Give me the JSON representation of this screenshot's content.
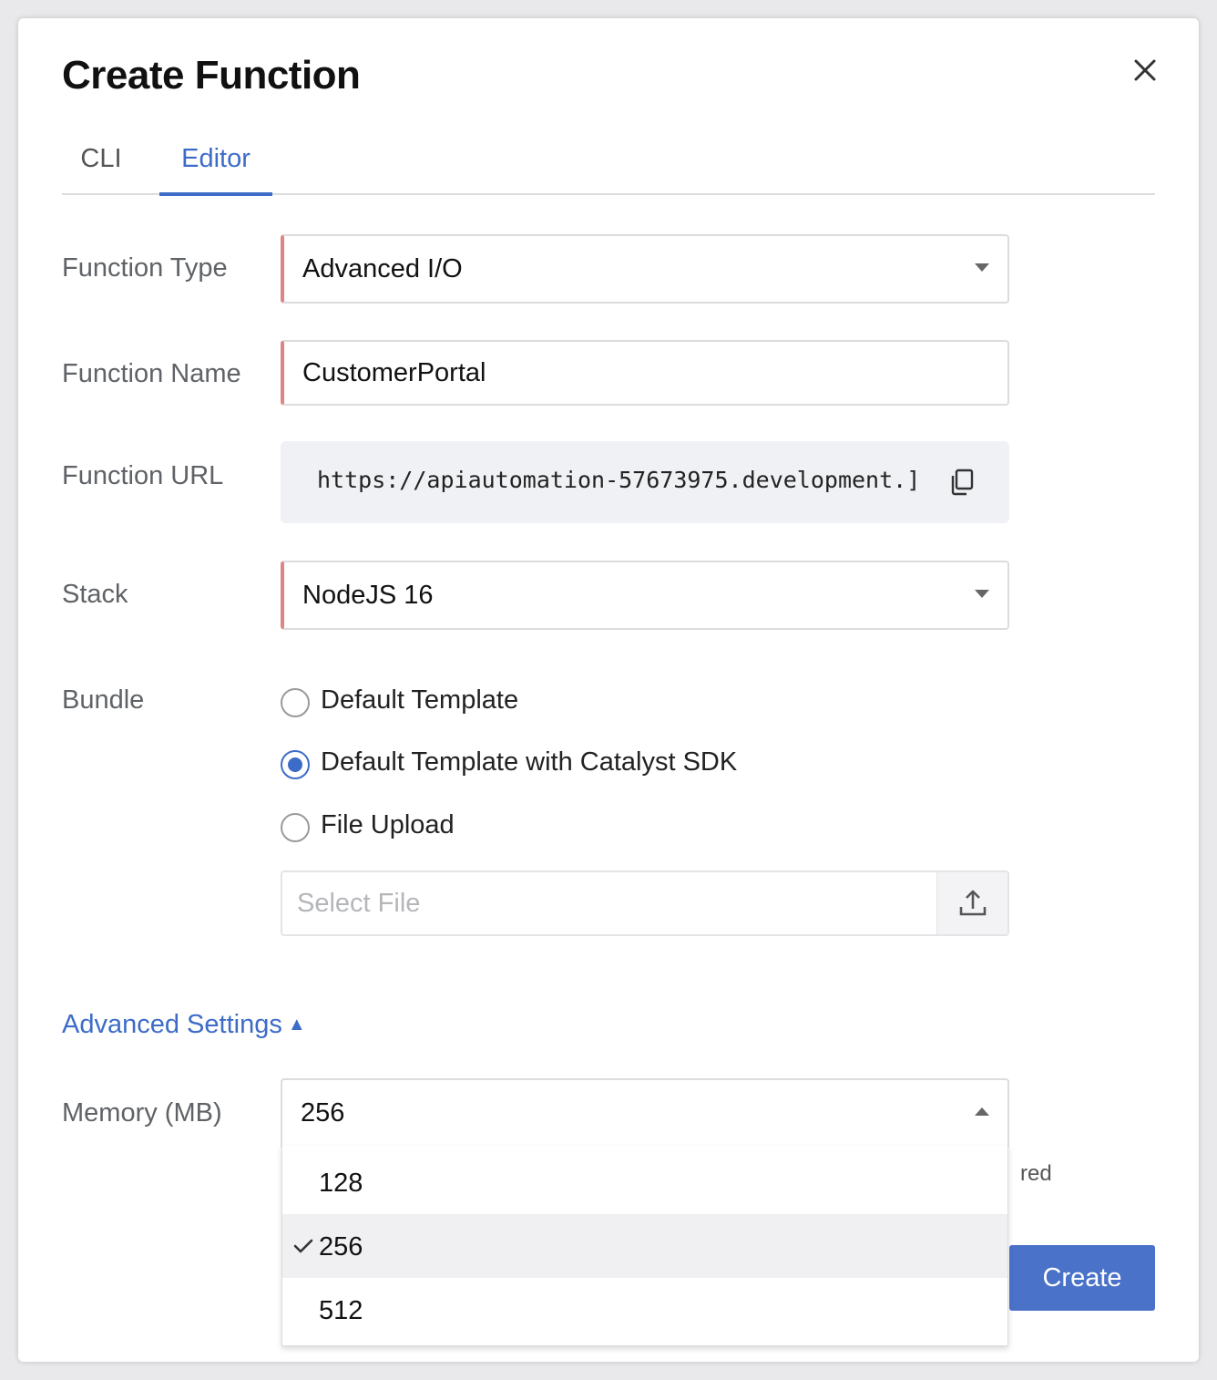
{
  "dialog": {
    "title": "Create Function",
    "close_icon": "close-icon"
  },
  "tabs": [
    {
      "label": "CLI",
      "active": false
    },
    {
      "label": "Editor",
      "active": true
    }
  ],
  "form": {
    "function_type": {
      "label": "Function Type",
      "value": "Advanced I/O"
    },
    "function_name": {
      "label": "Function Name",
      "value": "CustomerPortal"
    },
    "function_url": {
      "label": "Function URL",
      "value": "https://apiautomation-57673975.development.]",
      "copy_icon": "copy-icon"
    },
    "stack": {
      "label": "Stack",
      "value": "NodeJS 16"
    },
    "bundle": {
      "label": "Bundle",
      "options": [
        {
          "label": "Default Template",
          "selected": false
        },
        {
          "label": "Default Template with Catalyst SDK",
          "selected": true
        },
        {
          "label": "File Upload",
          "selected": false
        }
      ],
      "file_placeholder": "Select File",
      "upload_icon": "upload-icon"
    },
    "advanced_settings": {
      "label": "Advanced Settings",
      "indicator": "▲"
    },
    "memory": {
      "label": "Memory (MB)",
      "value": "256",
      "options": [
        "128",
        "256",
        "512"
      ],
      "selected": "256"
    },
    "partial_text": "red"
  },
  "actions": {
    "create_label": "Create"
  },
  "colors": {
    "accent": "#3d6cc8",
    "button": "#4a72c9",
    "required_border": "#e08585"
  }
}
